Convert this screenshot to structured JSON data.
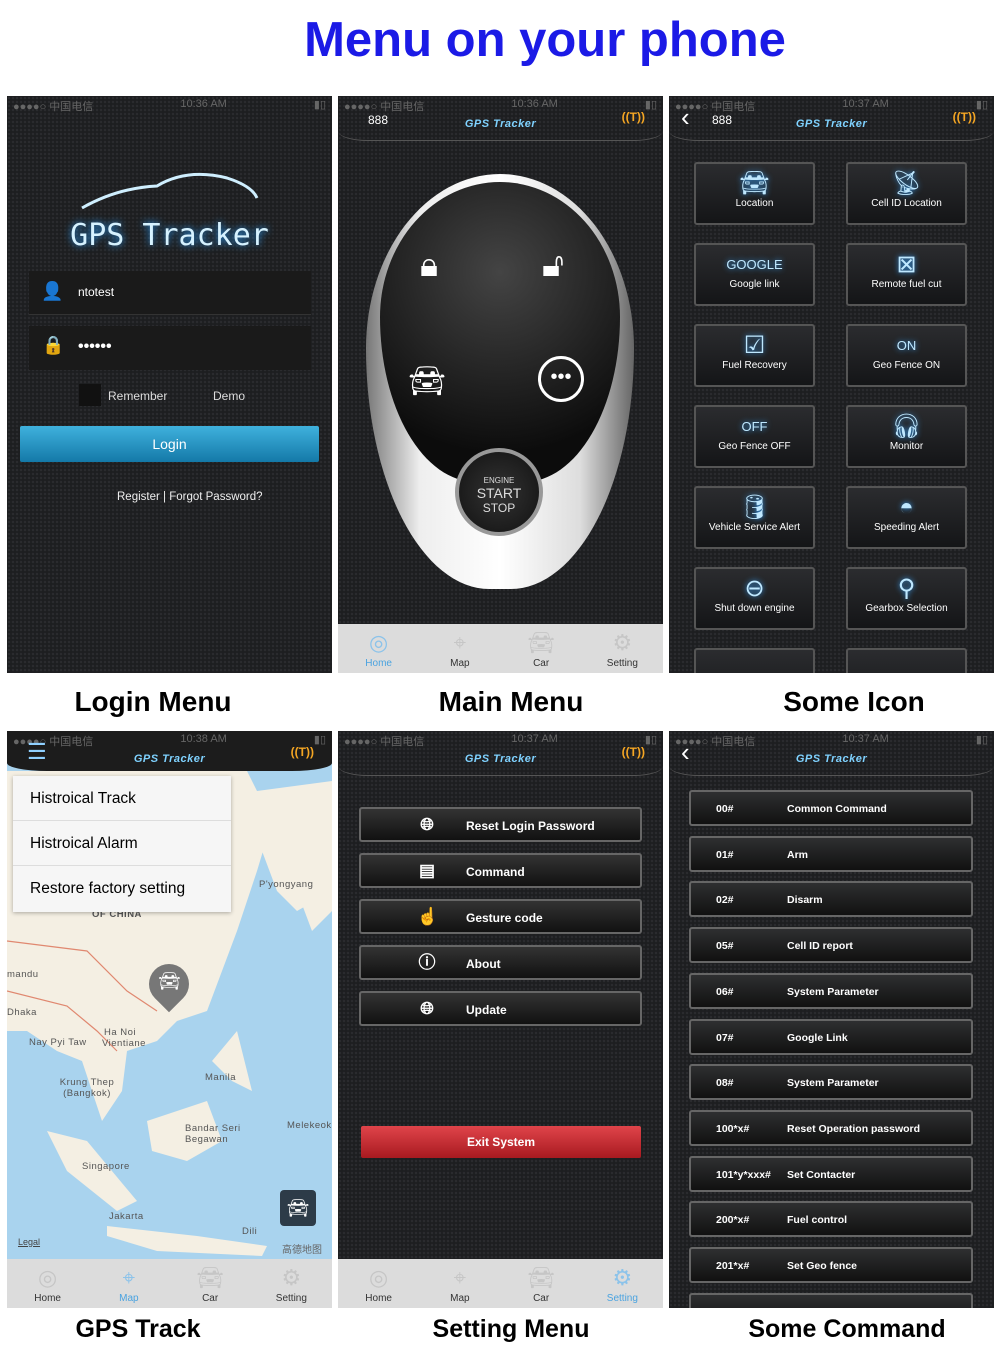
{
  "title": "Menu on your phone",
  "captions": {
    "login": "Login Menu",
    "main": "Main Menu",
    "icons": "Some Icon",
    "track": "GPS Track",
    "setting": "Setting Menu",
    "command": "Some Command"
  },
  "brand": "GPS Tracker",
  "status": {
    "carrier": "●●●●○ 中国电信",
    "t1": "10:36 AM",
    "t2": "10:36 AM",
    "t3": "10:37 AM",
    "t4": "10:38 AM",
    "t5": "10:37 AM",
    "t6": "10:37 AM"
  },
  "device_id": "888",
  "login": {
    "username": "ntotest",
    "password": "••••••",
    "remember": "Remember",
    "demo": "Demo",
    "login_button": "Login",
    "links": "Register | Forgot Password?"
  },
  "main": {
    "engine": "ENGINE",
    "start": "START",
    "stop": "STOP"
  },
  "tabs": [
    "Home",
    "Map",
    "Car",
    "Setting"
  ],
  "icons": [
    {
      "label": "Location",
      "icon": "location-car-icon"
    },
    {
      "label": "Cell ID Location",
      "icon": "cell-tower-icon"
    },
    {
      "label": "Google link",
      "icon": "google-link-icon",
      "glyph": "GOOGLE"
    },
    {
      "label": "Remote fuel cut",
      "icon": "engine-x-icon"
    },
    {
      "label": "Fuel Recovery",
      "icon": "engine-check-icon"
    },
    {
      "label": "Geo Fence ON",
      "icon": "geofence-on-icon",
      "glyph": "ON"
    },
    {
      "label": "Geo Fence OFF",
      "icon": "geofence-off-icon",
      "glyph": "OFF"
    },
    {
      "label": "Monitor",
      "icon": "headphones-icon"
    },
    {
      "label": "Vehicle Service Alert",
      "icon": "oil-can-icon"
    },
    {
      "label": "Speeding Alert",
      "icon": "speedometer-icon"
    },
    {
      "label": "Shut down engine",
      "icon": "ignition-icon"
    },
    {
      "label": "Gearbox  Selection",
      "icon": "gearbox-icon"
    }
  ],
  "track": {
    "menu": [
      "Histroical Track",
      "Histroical Alarm",
      "Restore factory setting"
    ],
    "map_labels": [
      "OF CHINA",
      "P'yongyang",
      "mandu",
      "Dhaka",
      "Ha Noi",
      "Nay Pyi Taw",
      "Vientiane",
      "Krung Thep (Bangkok)",
      "Manila",
      "Bandar Seri Begawan",
      "Melekeok",
      "Singapore",
      "Jakarta",
      "Dili"
    ],
    "legal": "Legal",
    "provider": "高德地图"
  },
  "setting": {
    "items": [
      {
        "label": "Reset Login Password",
        "icon": "globe-icon"
      },
      {
        "label": "Command",
        "icon": "document-icon"
      },
      {
        "label": "Gesture code",
        "icon": "hand-pointer-icon"
      },
      {
        "label": "About",
        "icon": "info-icon"
      },
      {
        "label": "Update",
        "icon": "globe-icon"
      }
    ],
    "exit": "Exit System"
  },
  "commands": [
    {
      "code": "00#",
      "label": "Common Command"
    },
    {
      "code": "01#",
      "label": "Arm"
    },
    {
      "code": "02#",
      "label": "Disarm"
    },
    {
      "code": "05#",
      "label": "Cell ID report"
    },
    {
      "code": "06#",
      "label": "System Parameter"
    },
    {
      "code": "07#",
      "label": "Google Link"
    },
    {
      "code": "08#",
      "label": "System Parameter"
    },
    {
      "code": "100*x#",
      "label": "Reset Operation password"
    },
    {
      "code": "101*y*xxx#",
      "label": "Set Contacter"
    },
    {
      "code": "200*x#",
      "label": "Fuel control"
    },
    {
      "code": "201*x#",
      "label": "Set Geo fence"
    }
  ],
  "colors": {
    "title": "#1b1ae6",
    "accent": "#4aa3e0",
    "exit": "#c8262c",
    "login": "#1f8fc2",
    "antenna": "#f5a623"
  }
}
